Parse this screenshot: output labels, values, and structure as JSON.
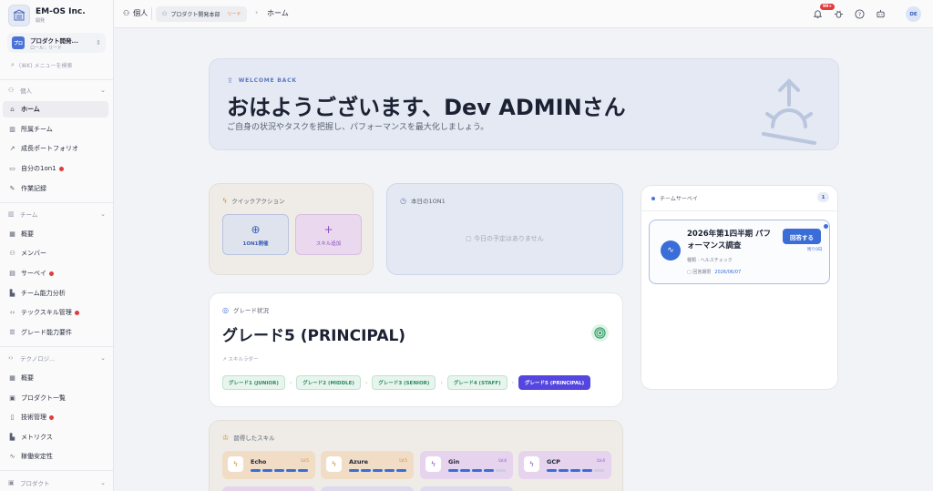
{
  "brand": {
    "name": "EM-OS Inc.",
    "sub": "開発"
  },
  "org": {
    "avatar": "プロ",
    "name": "プロダクト開発...",
    "role": "ロール：リード"
  },
  "side_search": {
    "placeholder": "(⌘K) メニューを検索"
  },
  "sidebar": {
    "groups": [
      {
        "label": "個人",
        "icon": "user-icon"
      },
      {
        "label": "チーム",
        "icon": "team-icon"
      },
      {
        "label": "テクノロジ...",
        "icon": "code-icon"
      },
      {
        "label": "プロダクト",
        "icon": "box-icon"
      }
    ],
    "personal": [
      {
        "label": "ホーム",
        "icon": "home-icon",
        "active": true,
        "dot": false
      },
      {
        "label": "所属チーム",
        "icon": "building-icon",
        "dot": false
      },
      {
        "label": "成長ポートフォリオ",
        "icon": "trend-icon",
        "dot": false
      },
      {
        "label": "自分の1on1",
        "icon": "chat-icon",
        "dot": true
      },
      {
        "label": "作業記録",
        "icon": "edit-icon",
        "dot": false
      }
    ],
    "team": [
      {
        "label": "概要",
        "icon": "grid-icon",
        "dot": false
      },
      {
        "label": "メンバー",
        "icon": "users-icon",
        "dot": false
      },
      {
        "label": "サーベイ",
        "icon": "clipboard-icon",
        "dot": true
      },
      {
        "label": "チーム能力分析",
        "icon": "chart-icon",
        "dot": false
      },
      {
        "label": "テックスキル管理",
        "icon": "code-icon",
        "dot": true
      },
      {
        "label": "グレード能力要件",
        "icon": "list-icon",
        "dot": false
      }
    ],
    "tech": [
      {
        "label": "概要",
        "icon": "grid-icon",
        "dot": false
      },
      {
        "label": "プロダクト一覧",
        "icon": "box-icon",
        "dot": false
      },
      {
        "label": "技術管理",
        "icon": "file-icon",
        "dot": true
      },
      {
        "label": "メトリクス",
        "icon": "chart-icon",
        "dot": false
      },
      {
        "label": "稼働安定性",
        "icon": "pulse-icon",
        "dot": false
      }
    ]
  },
  "topbar": {
    "personal": "個人",
    "org_chip": "プロダクト開発本部",
    "org_role": "リード",
    "page": "ホーム",
    "notif_count": "99+",
    "avatar": "DE"
  },
  "hero": {
    "badge": "WELCOME BACK",
    "title": "おはようございます、Dev ADMINさん",
    "subtitle": "ご自身の状況やタスクを把握し、パフォーマンスを最大化しましょう。"
  },
  "quick_actions": {
    "title": "クイックアクション",
    "buttons": [
      {
        "label": "1ON1開催"
      },
      {
        "label": "スキル追加"
      }
    ]
  },
  "today": {
    "title": "本日の1ON1",
    "empty": "今日の予定はありません"
  },
  "survey": {
    "title": "チームサーベイ",
    "count": "1",
    "item": {
      "title": "2026年第1四半期 パフォーマンス調査",
      "type_label": "種類",
      "type_value": "ヘルスチェック",
      "deadline_label": "回答期限",
      "deadline": "2026/06/07",
      "answer": "回答する",
      "remaining": "残り0日"
    }
  },
  "grade": {
    "label": "グレード状況",
    "current": "グレード5 (PRINCIPAL)",
    "ladder": "スキルラダー",
    "steps": [
      {
        "label": "グレード1 (JUNIOR)",
        "current": false
      },
      {
        "label": "グレード2 (MIDDLE)",
        "current": false
      },
      {
        "label": "グレード3 (SENIOR)",
        "current": false
      },
      {
        "label": "グレード4 (STAFF)",
        "current": false
      },
      {
        "label": "グレード5 (PRINCIPAL)",
        "current": true
      }
    ]
  },
  "skills": {
    "title": "習得したスキル",
    "items": [
      {
        "name": "Echo",
        "level": "LV.5",
        "filled": 5,
        "color": "orange"
      },
      {
        "name": "Azure",
        "level": "LV.5",
        "filled": 5,
        "color": "orange"
      },
      {
        "name": "Gin",
        "level": "LV.4",
        "filled": 4,
        "color": "purple"
      },
      {
        "name": "GCP",
        "level": "LV.4",
        "filled": 4,
        "color": "purple"
      }
    ]
  }
}
